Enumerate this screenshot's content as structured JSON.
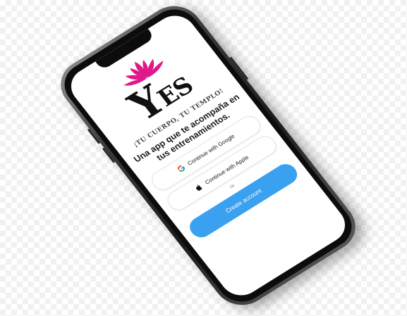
{
  "app": {
    "logo_big": "Y",
    "logo_small": "ES",
    "tagline": "¡TU CUERPO, TU TEMPLO!",
    "subtitle": "Una app que te acompaña en tus entrenamientos."
  },
  "auth": {
    "google_label": "Continue with Google",
    "apple_label": "Continue with Apple",
    "or_label": "Or",
    "create_label": "Create account"
  },
  "colors": {
    "lotus": "#e0198a",
    "primary_button": "#3aa0f0",
    "logo": "#111111"
  },
  "icons": {
    "logo_mark": "lotus-icon",
    "google": "google-icon",
    "apple": "apple-icon"
  }
}
